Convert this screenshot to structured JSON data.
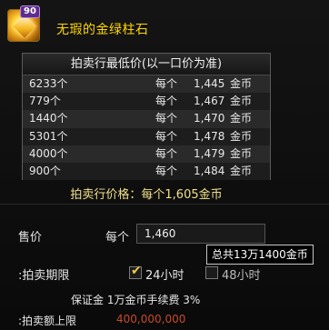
{
  "item": {
    "name": "无瑕的金绿柱石",
    "level": "90"
  },
  "price_table": {
    "header": "拍卖行最低价(以一口价为准)",
    "rows": [
      {
        "qty": "6233个",
        "per": "每个",
        "price": "1,445",
        "unit": "金币"
      },
      {
        "qty": "779个",
        "per": "每个",
        "price": "1,467",
        "unit": "金币"
      },
      {
        "qty": "1440个",
        "per": "每个",
        "price": "1,470",
        "unit": "金币"
      },
      {
        "qty": "5301个",
        "per": "每个",
        "price": "1,478",
        "unit": "金币"
      },
      {
        "qty": "4000个",
        "per": "每个",
        "price": "1,479",
        "unit": "金币"
      },
      {
        "qty": "900个",
        "per": "每个",
        "price": "1,484",
        "unit": "金币"
      }
    ]
  },
  "summary": "拍卖行价格：每个1,605金币",
  "sell": {
    "label": "售价",
    "per_label": "每个",
    "input_value": "1,460",
    "tooltip": "总共13万1400金币"
  },
  "period": {
    "label": ":拍卖期限",
    "opt_24": "24小时",
    "opt_48": "48小时",
    "checked_24": true,
    "checked_48": false
  },
  "deposit": "保证金 1万金币手续费 3%",
  "limit": {
    "label": ":拍卖额上限",
    "value": "400,000,000"
  }
}
